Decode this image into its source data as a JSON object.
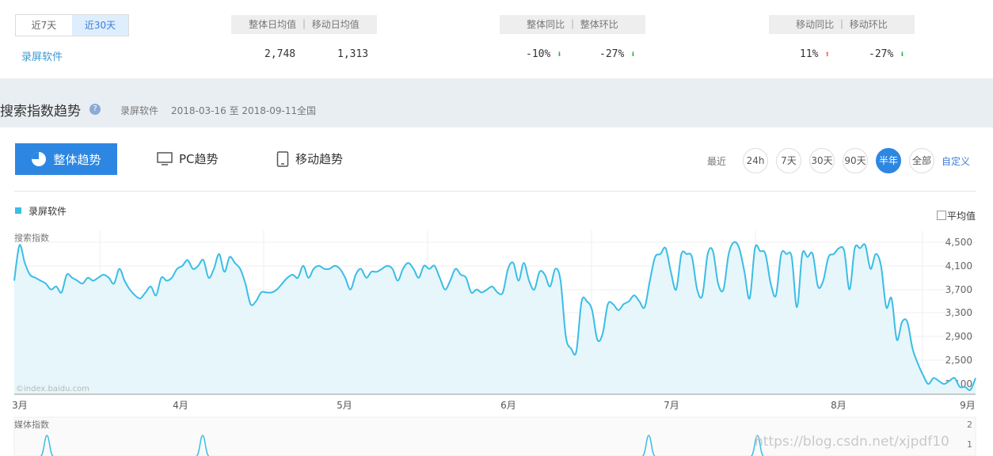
{
  "summary": {
    "tabs": [
      {
        "label": "近7天",
        "active": false
      },
      {
        "label": "近30天",
        "active": true
      }
    ],
    "keyword": "录屏软件",
    "headers": {
      "avg": "整体日均值 ｜ 移动日均值",
      "overall_ratio": "整体同比 ｜ 整体环比",
      "mobile_ratio": "移动同比 ｜ 移动环比"
    },
    "values": {
      "overall_avg": "2,748",
      "mobile_avg": "1,313",
      "overall_yoy": "-10%",
      "overall_mom": "-27%",
      "mobile_yoy": "11%",
      "mobile_mom": "-27%"
    },
    "colors": {
      "down": "#2fb241",
      "up": "#e86155"
    }
  },
  "section": {
    "title": "搜索指数趋势",
    "help_icon": "question-icon",
    "keyword": "录屏软件",
    "date_range": "2018-03-16 至 2018-09-11",
    "region": "全国"
  },
  "view_tabs": {
    "overall": "整体趋势",
    "pc": "PC趋势",
    "mobile": "移动趋势"
  },
  "range": {
    "label": "最近",
    "options": [
      "24h",
      "7天",
      "30天",
      "90天",
      "半年",
      "全部"
    ],
    "active": "半年",
    "custom": "自定义"
  },
  "legend": {
    "series_name": "录屏软件",
    "avg_label": "平均值",
    "color": "#3bbde5"
  },
  "chart_data": [
    {
      "type": "area",
      "ylabel": "搜索指数",
      "watermark": "©index.baidu.com",
      "y_ticks": [
        "4,500",
        "4,100",
        "3,700",
        "3,300",
        "2,900",
        "2,500",
        "2,100"
      ],
      "ylim": [
        1900,
        4700
      ],
      "x_ticks": [
        "3月",
        "4月",
        "5月",
        "6月",
        "7月",
        "8月",
        "9月"
      ],
      "series": [
        {
          "name": "录屏软件",
          "values": [
            3850,
            4450,
            4150,
            3950,
            3900,
            3850,
            3800,
            3700,
            3750,
            3650,
            3950,
            3900,
            3850,
            3800,
            3900,
            3850,
            3900,
            3950,
            3900,
            3800,
            4050,
            3850,
            3700,
            3600,
            3550,
            3650,
            3750,
            3600,
            3900,
            3850,
            3900,
            4050,
            4100,
            4200,
            4050,
            4100,
            4200,
            3900,
            4050,
            4300,
            4000,
            4250,
            4150,
            4050,
            3800,
            3450,
            3500,
            3650,
            3650,
            3650,
            3700,
            3800,
            3900,
            3950,
            3900,
            4100,
            3900,
            4050,
            4100,
            4050,
            4050,
            4100,
            4050,
            3900,
            3700,
            3950,
            4050,
            3900,
            4000,
            4000,
            4050,
            4100,
            4050,
            3850,
            4050,
            4150,
            4050,
            3900,
            4100,
            4050,
            4100,
            3900,
            3700,
            3850,
            4050,
            3950,
            3900,
            3650,
            3700,
            3650,
            3700,
            3750,
            3650,
            3650,
            4050,
            4150,
            3850,
            4150,
            3850,
            3700,
            4000,
            3950,
            3750,
            4050,
            3850,
            2900,
            2700,
            2650,
            3500,
            3500,
            3350,
            2850,
            2950,
            3450,
            3450,
            3350,
            3450,
            3500,
            3600,
            3500,
            3400,
            3850,
            4250,
            4300,
            4400,
            4000,
            3700,
            4300,
            4300,
            4250,
            3700,
            3600,
            4300,
            4350,
            3800,
            3700,
            4300,
            4500,
            4400,
            4000,
            3550,
            4400,
            4350,
            4300,
            3800,
            3600,
            4300,
            4300,
            4250,
            3400,
            4300,
            4250,
            4300,
            3750,
            3850,
            4250,
            4300,
            4400,
            4350,
            3700,
            4400,
            4400,
            4450,
            4050,
            4300,
            4100,
            3400,
            3550,
            2850,
            3150,
            3150,
            2700,
            2450,
            2250,
            2100,
            2200,
            2150,
            2100,
            2150,
            2200,
            2050,
            2050,
            2000,
            2200
          ]
        }
      ]
    },
    {
      "type": "line",
      "ylabel": "媒体指数",
      "y_ticks": [
        "2",
        "1"
      ],
      "ylim": [
        0,
        2
      ],
      "series": [
        {
          "name": "录屏软件",
          "spikes": [
            {
              "x": 0.034,
              "value": 1
            },
            {
              "x": 0.196,
              "value": 1
            },
            {
              "x": 0.66,
              "value": 1
            },
            {
              "x": 0.773,
              "value": 1
            }
          ]
        }
      ]
    }
  ],
  "watermark_text": "https://blog.csdn.net/xjpdf10"
}
